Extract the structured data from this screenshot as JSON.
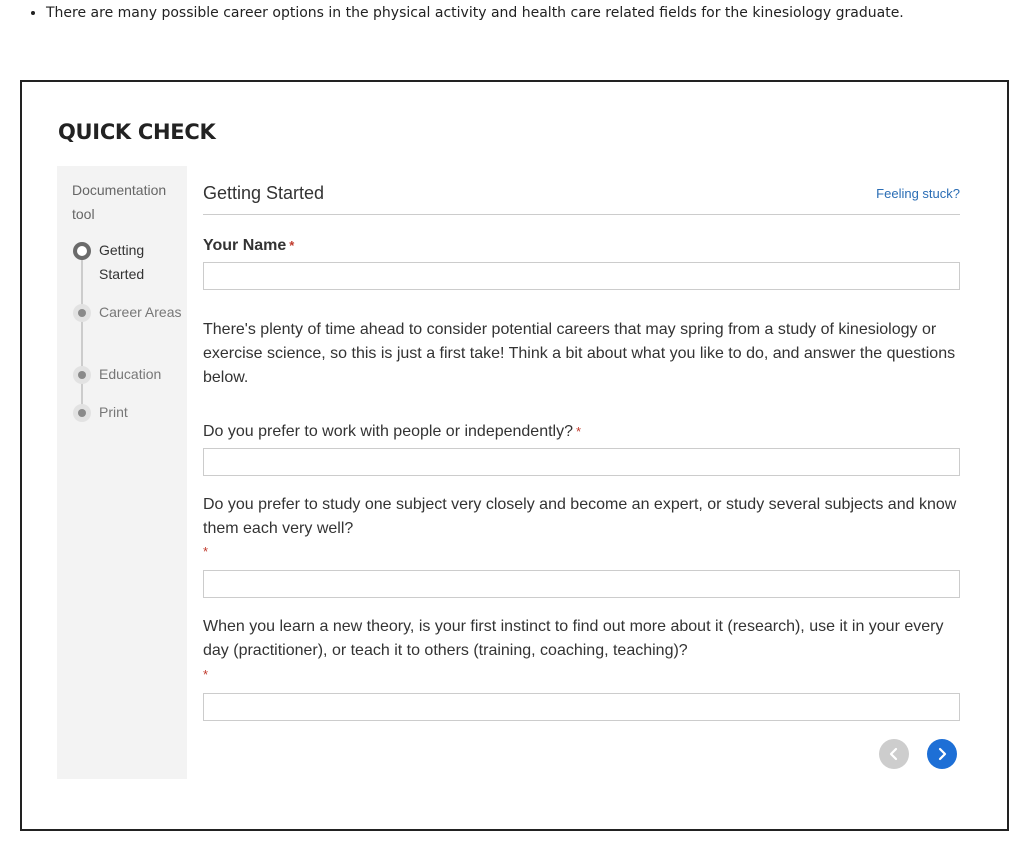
{
  "intro": {
    "bullet": "There are many possible career options in the physical activity and health care related fields for the kinesiology graduate."
  },
  "quick_check": {
    "title": "QUICK CHECK",
    "sidebar": {
      "heading": "Documentation tool",
      "steps": [
        {
          "label": "Getting Started",
          "state": "active"
        },
        {
          "label": "Career Areas",
          "state": "inactive"
        },
        {
          "label": "Education",
          "state": "inactive"
        },
        {
          "label": "Print",
          "state": "inactive"
        }
      ]
    },
    "section_title": "Getting Started",
    "help_link": "Feeling stuck?",
    "required_marker": "*",
    "name_label": "Your Name",
    "name_value": "",
    "intro_text": "There's plenty of time ahead to consider potential careers that may spring from a study of kinesiology or exercise science, so this is just a first take! Think a bit about what you like to do, and answer the questions below.",
    "questions": [
      {
        "label": "Do you prefer to work with people or independently?",
        "value": ""
      },
      {
        "label": "Do you prefer to study one subject very closely and become an expert, or study several subjects and know them each very well?",
        "value": ""
      },
      {
        "label": "When you learn a new theory, is your first instinct to find out more about it (research), use it in your every day (practitioner), or teach it to others (training, coaching, teaching)?",
        "value": ""
      }
    ],
    "nav": {
      "prev_icon": "chevron-left-icon",
      "next_icon": "chevron-right-icon",
      "prev_enabled": false,
      "next_enabled": true
    },
    "colors": {
      "accent": "#1d6fd6",
      "link": "#2a6db5",
      "required": "#c0392b",
      "sidebar_bg": "#f3f3f3"
    }
  }
}
